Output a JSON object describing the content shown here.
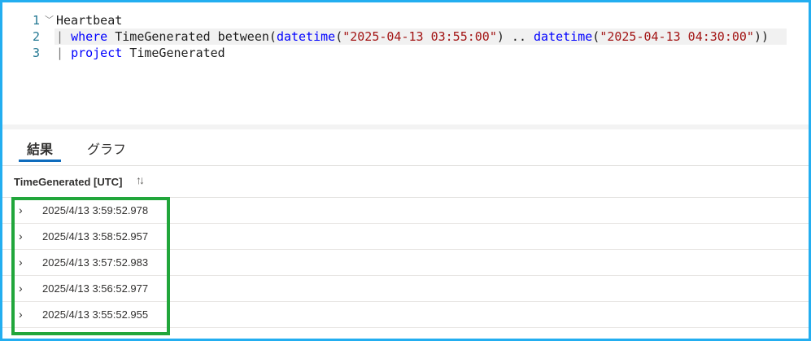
{
  "editor": {
    "lines": [
      {
        "number": "1",
        "parts": {
          "a": "Heartbeat"
        }
      },
      {
        "number": "2",
        "parts": {
          "pipe": "| ",
          "kw": "where",
          "a": " TimeGenerated between(",
          "fn1": "datetime",
          "b": "(",
          "s1": "\"2025-04-13 03:55:00\"",
          "c": ") .. ",
          "fn2": "datetime",
          "d": "(",
          "s2": "\"2025-04-13 04:30:00\"",
          "e": "))"
        }
      },
      {
        "number": "3",
        "parts": {
          "pipe": "| ",
          "kw": "project",
          "a": " TimeGenerated"
        }
      }
    ]
  },
  "tabs": {
    "results": "結果",
    "chart": "グラフ"
  },
  "grid": {
    "column_header": "TimeGenerated [UTC]",
    "sort_icon": "↑↓",
    "rows": [
      "2025/4/13 3:59:52.978",
      "2025/4/13 3:58:52.957",
      "2025/4/13 3:57:52.983",
      "2025/4/13 3:56:52.977",
      "2025/4/13 3:55:52.955"
    ]
  },
  "colors": {
    "frame_border": "#23aef0",
    "highlight_box": "#21a63b",
    "active_tab_underline": "#0f6cbd",
    "keyword": "#0000ff",
    "string": "#a31515"
  },
  "icons": {
    "fold": "chevron-down-icon",
    "row_expand": "chevron-right-icon",
    "sort": "sort-icon"
  }
}
